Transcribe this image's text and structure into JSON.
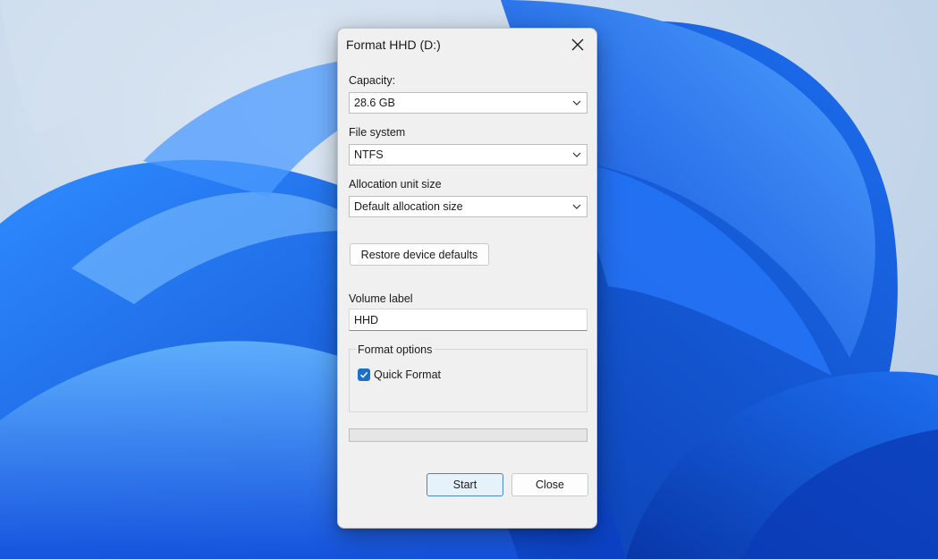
{
  "dialog": {
    "title": "Format HHD (D:)"
  },
  "capacity": {
    "label": "Capacity:",
    "value": "28.6 GB"
  },
  "file_system": {
    "label": "File system",
    "value": "NTFS"
  },
  "allocation": {
    "label": "Allocation unit size",
    "value": "Default allocation size"
  },
  "restore_button": "Restore device defaults",
  "volume": {
    "label": "Volume label",
    "value": "HHD"
  },
  "format_options": {
    "legend": "Format options",
    "quick_format": {
      "label": "Quick Format",
      "checked": true
    }
  },
  "progress": {
    "fraction": 0
  },
  "buttons": {
    "start": "Start",
    "close": "Close"
  },
  "icons": {
    "close": "close-icon",
    "dropdown": "chevron-down-icon",
    "check": "checkmark-icon"
  },
  "colors": {
    "checkbox_accent": "#1c6fc9",
    "primary_button_border": "#4a86c5",
    "primary_button_fill": "#e5f1fb",
    "dialog_background": "#f0f0f0"
  }
}
